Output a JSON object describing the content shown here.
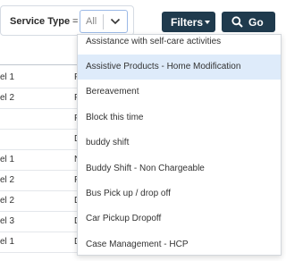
{
  "filter_bar": {
    "service_type_label": "Service Type",
    "equals_sign": "=",
    "select_value": "All",
    "filters_button": "Filters",
    "go_button": "Go"
  },
  "table": {
    "rows": [
      {
        "col1": "el 1",
        "col2": "F"
      },
      {
        "col1": "el 2",
        "col2": "F"
      },
      {
        "col1": "",
        "col2": "F"
      },
      {
        "col1": "",
        "col2": "D"
      },
      {
        "col1": "el 1",
        "col2": "N"
      },
      {
        "col1": "el 2",
        "col2": "F"
      },
      {
        "col1": "el 2",
        "col2": "D"
      },
      {
        "col1": "el 3",
        "col2": "D"
      },
      {
        "col1": "el 1",
        "col2": "D"
      }
    ]
  },
  "dropdown": {
    "options": [
      "Assistance with self-care activities",
      "Assistive Products - Home Modification",
      "Bereavement",
      "Block this time",
      "buddy shift",
      "Buddy Shift - Non Chargeable",
      "Bus Pick up / drop off",
      "Car Pickup Dropoff",
      "Case Management - HCP"
    ],
    "highlighted_option": "Assistive Products - Home Modification"
  },
  "colors": {
    "button_bg": "#1f3a4d",
    "highlight_bg": "#deebfa",
    "select_border": "#9bb9e6"
  },
  "icons": [
    "chevron-down-icon",
    "caret-down-icon",
    "search-icon"
  ]
}
